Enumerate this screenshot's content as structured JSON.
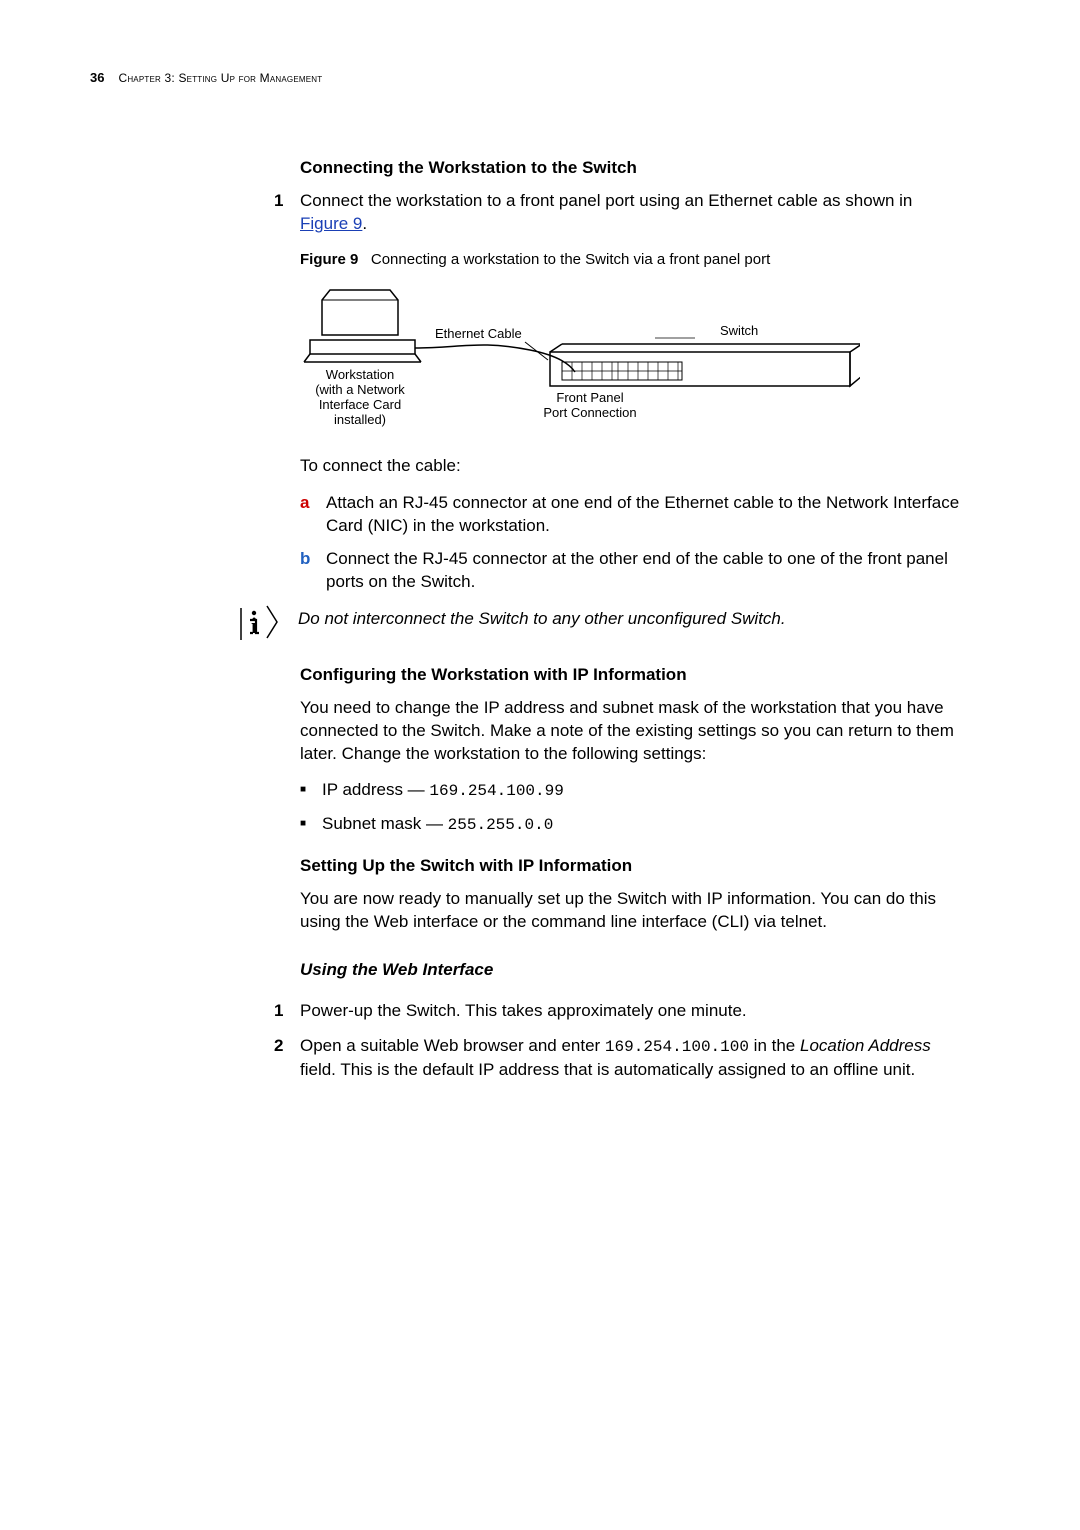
{
  "header": {
    "page_number": "36",
    "chapter_label": "Chapter 3: Setting Up for Management"
  },
  "sec1": {
    "heading": "Connecting the Workstation to the Switch",
    "step1_marker": "1",
    "step1_text_a": "Connect the workstation to a front panel port using an Ethernet cable as shown in ",
    "step1_link": "Figure 9",
    "step1_text_b": ".",
    "fig_label": "Figure 9",
    "fig_caption": "Connecting a workstation to the Switch via a front panel port",
    "fig_labels": {
      "ethernet": "Ethernet Cable",
      "switch": "Switch",
      "workstation_l1": "Workstation",
      "workstation_l2": "(with a Network",
      "workstation_l3": "Interface Card",
      "workstation_l4": "installed)",
      "front_l1": "Front Panel",
      "front_l2": "Port Connection"
    },
    "connect_intro": "To connect the cable:",
    "a_marker": "a",
    "a_text": "Attach an RJ-45 connector at one end of the Ethernet cable to the Network Interface Card (NIC) in the workstation.",
    "b_marker": "b",
    "b_text": "Connect the RJ-45 connector at the other end of the cable to one of the front panel ports on the Switch.",
    "note": "Do not interconnect the Switch to any other unconfigured Switch."
  },
  "sec2": {
    "heading": "Configuring the Workstation with IP Information",
    "para": "You need to change the IP address and subnet mask of the workstation that you have connected to the Switch. Make a note of the existing settings so you can return to them later. Change the workstation to the following settings:",
    "ip_label": "IP address — ",
    "ip_value": "169.254.100.99",
    "mask_label": "Subnet mask — ",
    "mask_value": "255.255.0.0"
  },
  "sec3": {
    "heading": "Setting Up the Switch with IP Information",
    "para1": "You are now ready to manually set up the Switch with IP information. You can do this using the Web interface or the command line interface (CLI) via telnet."
  },
  "sec4": {
    "heading": "Using the Web Interface",
    "s1_marker": "1",
    "s1_text": "Power-up the Switch. This takes approximately one minute.",
    "s2_marker": "2",
    "s2_a": "Open a suitable Web browser and enter ",
    "s2_code": "169.254.100.100",
    "s2_b": " in the ",
    "s2_i": "Location Address",
    "s2_c": " field. This is the default IP address that is automatically assigned to an offline unit."
  },
  "icon_letter": "i"
}
